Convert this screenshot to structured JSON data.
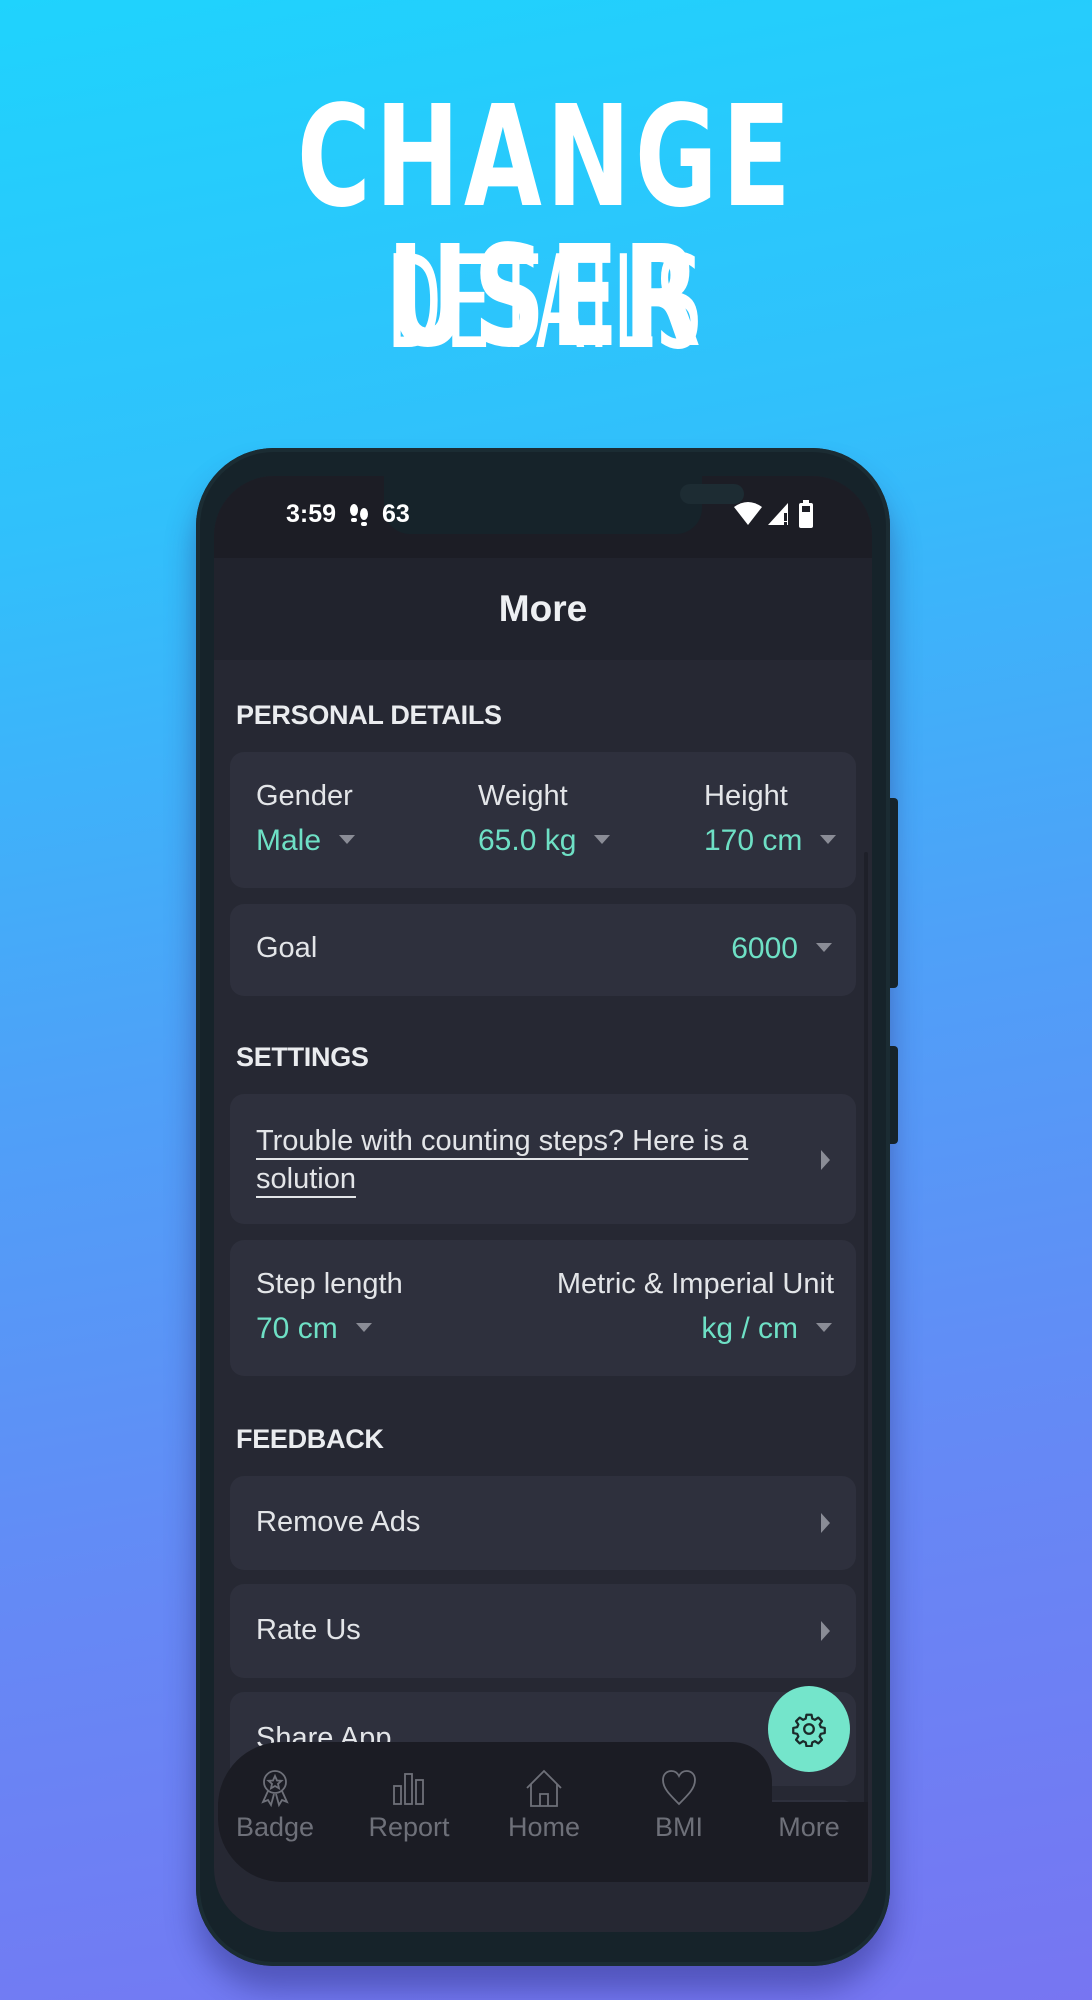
{
  "promo": {
    "headline_line1": "CHANGE USER",
    "headline_line2": "DETAILS"
  },
  "status_bar": {
    "time": "3:59",
    "steps_icon": "footsteps-icon",
    "notification_text": "63",
    "icons": [
      "wifi-icon",
      "cellular-signal-icon",
      "battery-icon"
    ]
  },
  "app_bar": {
    "title": "More"
  },
  "colors": {
    "accent": "#6ee0c5",
    "fab": "#74e5cb",
    "background": "#262833",
    "card": "#2e303d"
  },
  "personal_details": {
    "section_title": "PERSONAL DETAILS",
    "gender": {
      "label": "Gender",
      "value": "Male"
    },
    "weight": {
      "label": "Weight",
      "value": "65.0 kg"
    },
    "height": {
      "label": "Height",
      "value": "170 cm"
    },
    "goal": {
      "label": "Goal",
      "value": "6000"
    }
  },
  "settings": {
    "section_title": "SETTINGS",
    "trouble_link": "Trouble with counting steps? Here is a solution",
    "step_length": {
      "label": "Step length",
      "value": "70 cm"
    },
    "units": {
      "label": "Metric & Imperial Unit",
      "value": "kg / cm"
    }
  },
  "feedback": {
    "section_title": "FEEDBACK",
    "items": [
      {
        "label": "Remove Ads"
      },
      {
        "label": "Rate Us"
      },
      {
        "label": "Share App"
      }
    ]
  },
  "bottom_nav": {
    "items": [
      {
        "label": "Badge",
        "icon": "badge-icon"
      },
      {
        "label": "Report",
        "icon": "bar-chart-icon"
      },
      {
        "label": "Home",
        "icon": "home-icon"
      },
      {
        "label": "BMI",
        "icon": "heart-icon"
      },
      {
        "label": "More",
        "icon": "gear-icon",
        "active": true
      }
    ]
  }
}
